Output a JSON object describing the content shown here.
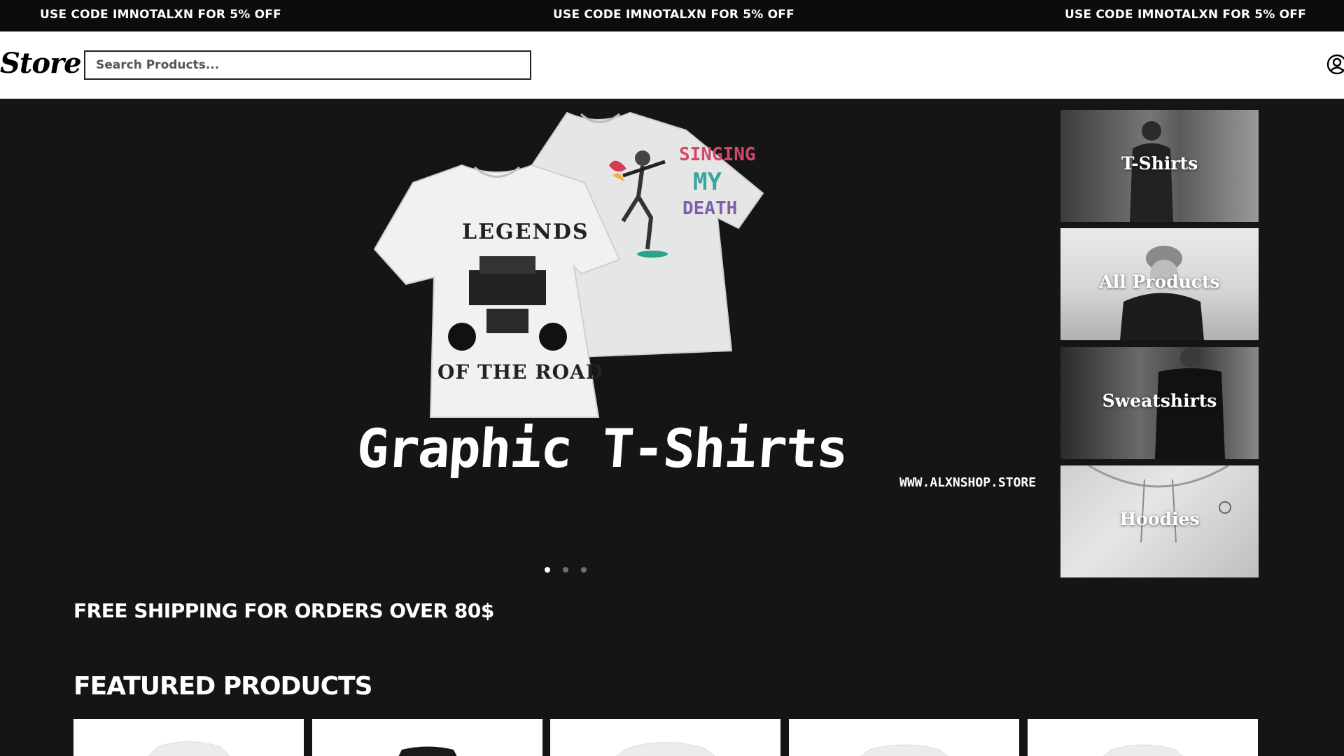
{
  "announcement": {
    "messages": [
      "USE CODE IMNOTALXN FOR 5% OFF",
      "USE CODE IMNOTALXN FOR 5% OFF",
      "USE CODE IMNOTALXN FOR 5% OFF"
    ]
  },
  "header": {
    "logo": "Store",
    "search_placeholder": "Search Products...",
    "account_icon": "user-circle-icon"
  },
  "hero": {
    "title": "Graphic T-Shirts",
    "url": "WWW.ALXNSHOP.STORE",
    "shirt_left_text_top": "LEGENDS",
    "shirt_left_text_bottom": "OF THE ROAD",
    "shirt_right_text": [
      "SINGING",
      "MY",
      "DEATH"
    ],
    "slide_count": 3,
    "active_slide": 1
  },
  "categories": [
    {
      "label": "T-Shirts"
    },
    {
      "label": "All Products"
    },
    {
      "label": "Sweatshirts"
    },
    {
      "label": "Hoodies"
    }
  ],
  "shipping_banner": "FREE SHIPPING FOR ORDERS OVER 80$",
  "featured": {
    "heading": "FEATURED PRODUCTS",
    "products": [
      {
        "color": "white"
      },
      {
        "color": "black"
      },
      {
        "color": "white"
      },
      {
        "color": "white"
      },
      {
        "color": "white"
      }
    ]
  },
  "colors": {
    "background": "#151515",
    "announcement_bg": "#0c0c0c",
    "header_bg": "#ffffff",
    "text": "#ffffff"
  }
}
